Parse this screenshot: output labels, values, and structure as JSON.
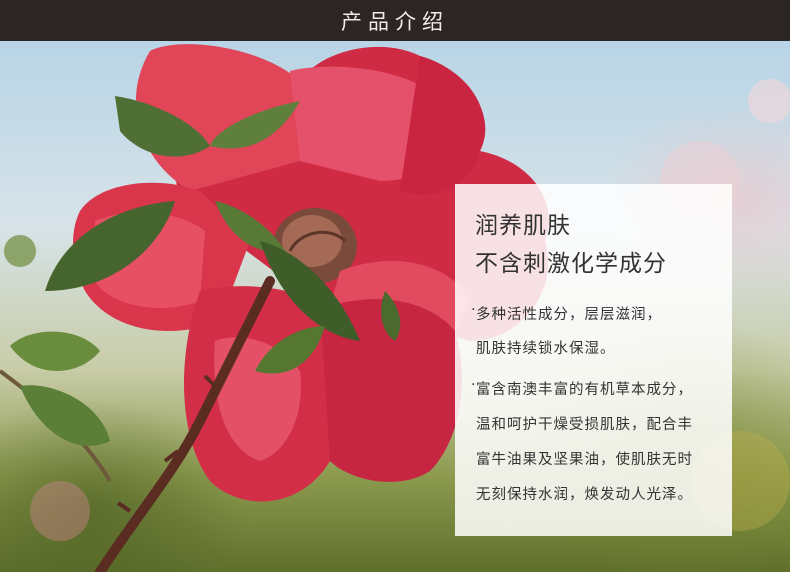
{
  "header": {
    "title": "产品介绍"
  },
  "panel": {
    "title_line1": "润养肌肤",
    "title_line2": "不含刺激化学成分",
    "point1": [
      "多种活性成分，层层滋润，",
      "肌肤持续锁水保湿。"
    ],
    "point2": [
      "富含南澳丰富的有机草本成分，",
      "温和呵护干燥受损肌肤，配合丰",
      "富牛油果及坚果油，使肌肤无时",
      "无刻保持水润，焕发动人光泽。"
    ],
    "bullet_mark": "·"
  },
  "colors": {
    "header_bg": "#2b2523",
    "header_text": "#f3ece8",
    "petal": "#d5344b",
    "leaf": "#4f6f35"
  }
}
